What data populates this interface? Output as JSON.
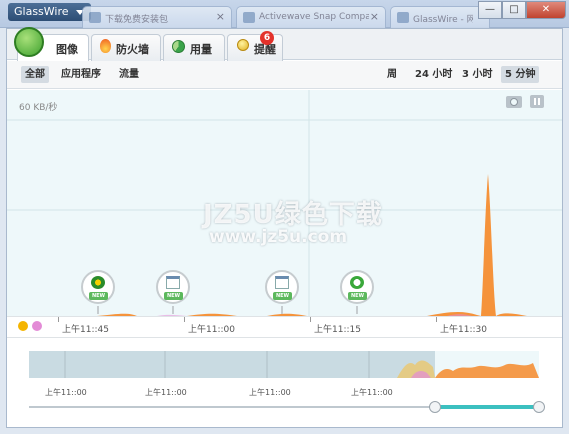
{
  "window": {
    "app_menu_label": "GlassWire",
    "browser_tabs": [
      "下载免费安装包",
      "Activewave Snap Compar...",
      "GlassWire - 网络..."
    ],
    "buttons": {
      "minimize": "—",
      "maximize": "□",
      "close": "✕"
    }
  },
  "main_tabs": [
    {
      "label": "图像",
      "icon": "graph-icon",
      "active": true
    },
    {
      "label": "防火墙",
      "icon": "flame-icon",
      "active": false
    },
    {
      "label": "用量",
      "icon": "pie-icon",
      "active": false
    },
    {
      "label": "提醒",
      "icon": "bell-icon",
      "active": false
    }
  ],
  "alert_count": "6",
  "view_modes": [
    "全部",
    "应用程序",
    "流量"
  ],
  "time_ranges": [
    "周",
    "24 小时",
    "3 小时",
    "5 分钟"
  ],
  "selected_time_range": "5 分钟",
  "graph": {
    "y_scale_label": "60 KB/秒",
    "watermark": "JZ5U绿色下载",
    "watermark_url": "www.jz5u.com",
    "x_ticks": [
      "上午11::45",
      "上午11::00",
      "上午11::15",
      "上午11::30"
    ],
    "pin_badge": "NEW",
    "pins": [
      "app-pin-1",
      "app-pin-2",
      "app-pin-3",
      "app-pin-4"
    ]
  },
  "timeline": {
    "x_ticks": [
      "上午11::00",
      "上午11::00",
      "上午11::00",
      "上午11::00"
    ]
  },
  "colors": {
    "download": "#f4b400",
    "upload": "#e38bd6",
    "spike": "#f58a2a",
    "accent": "#3cc0c0"
  }
}
